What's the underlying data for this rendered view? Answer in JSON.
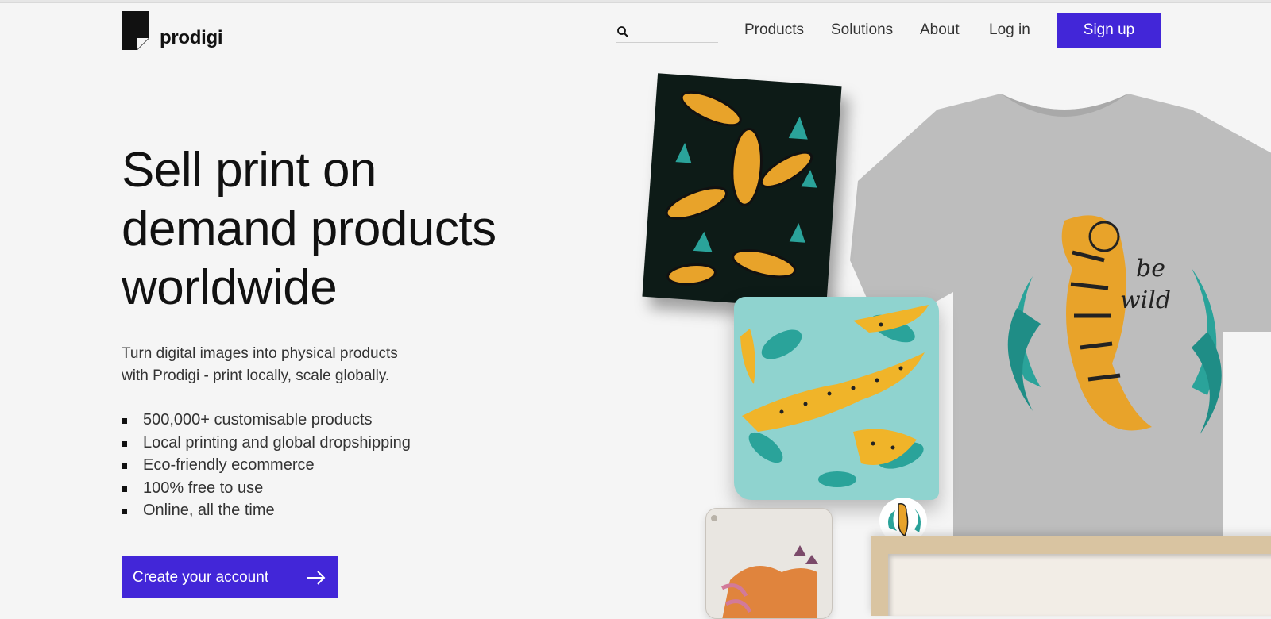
{
  "brand": {
    "name": "prodigi"
  },
  "header": {
    "search_placeholder": "",
    "nav": [
      {
        "label": "Products"
      },
      {
        "label": "Solutions"
      },
      {
        "label": "About"
      },
      {
        "label": "Log in"
      }
    ],
    "signup_label": "Sign up"
  },
  "hero": {
    "title_lines": [
      "Sell print on",
      "demand products",
      "worldwide"
    ],
    "subtitle_lines": [
      "Turn digital images into physical products",
      "with Prodigi - print locally, scale globally."
    ],
    "features": [
      "500,000+ customisable products",
      "Local printing and global dropshipping",
      "Eco-friendly ecommerce",
      "100% free to use",
      "Online, all the time"
    ],
    "cta_label": "Create your account"
  },
  "colors": {
    "accent": "#4226d8",
    "background": "#f5f5f5",
    "text": "#111111"
  },
  "icons": {
    "search": "search-icon",
    "cta_arrow": "arrow-right-icon",
    "logo": "prodigi-logo-mark"
  }
}
